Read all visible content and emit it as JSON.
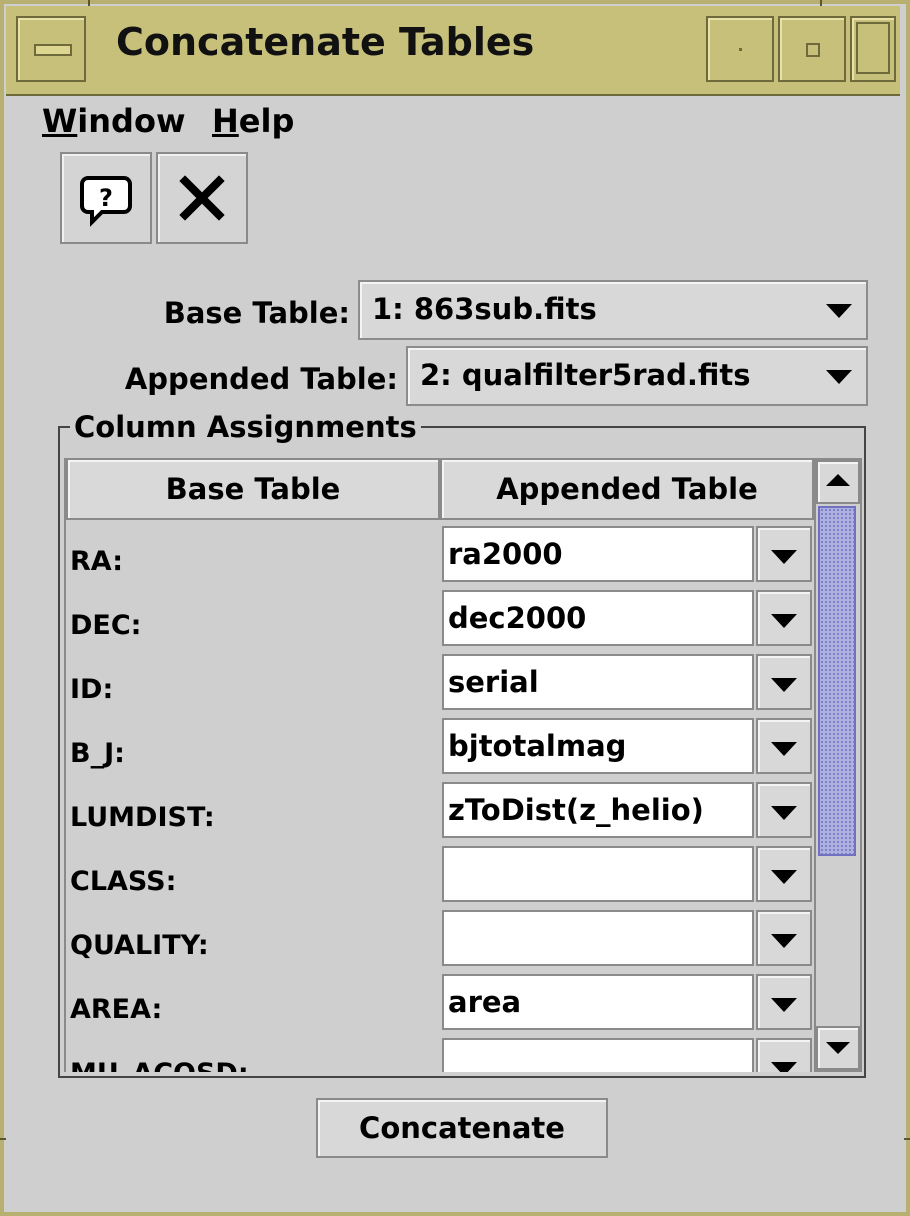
{
  "window": {
    "title": "Concatenate Tables",
    "frame_color": "#c7c07a"
  },
  "menubar": {
    "items": [
      {
        "label": "Window",
        "mnemonic": "W",
        "rest": "indow"
      },
      {
        "label": "Help",
        "mnemonic": "H",
        "rest": "elp"
      }
    ]
  },
  "toolbar": {
    "help_icon": "help-bubble-icon",
    "close_icon": "close-x-icon"
  },
  "selectors": {
    "base_label": "Base Table:",
    "base_value": "1: 863sub.fits",
    "appended_label": "Appended Table:",
    "appended_value": "2: qualfilter5rad.fits"
  },
  "assignments": {
    "group_title": "Column Assignments",
    "headers": [
      "Base Table",
      "Appended Table"
    ],
    "rows": [
      {
        "base": "RA:",
        "appended": "ra2000"
      },
      {
        "base": "DEC:",
        "appended": "dec2000"
      },
      {
        "base": "ID:",
        "appended": "serial"
      },
      {
        "base": "B_J:",
        "appended": "bjtotalmag"
      },
      {
        "base": "LUMDIST:",
        "appended": "zToDist(z_helio)"
      },
      {
        "base": "CLASS:",
        "appended": ""
      },
      {
        "base": "QUALITY:",
        "appended": ""
      },
      {
        "base": "AREA:",
        "appended": "area"
      },
      {
        "base": "MU_ACOSD:",
        "appended": ""
      }
    ],
    "scroll_thumb_color": "#aeb0e0"
  },
  "actions": {
    "concatenate_label": "Concatenate"
  }
}
